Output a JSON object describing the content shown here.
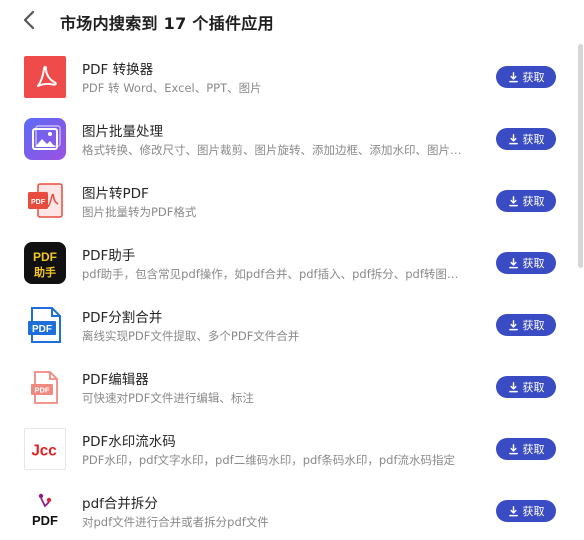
{
  "header": {
    "title": "市场内搜索到 17 个插件应用"
  },
  "plugins": [
    {
      "name": "PDF 转换器",
      "desc": "PDF 转 Word、Excel、PPT、图片",
      "button": "获取",
      "icon": "pdf-converter-icon"
    },
    {
      "name": "图片批量处理",
      "desc": "格式转换、修改尺寸、图片裁剪、图片旋转、添加边框、添加水印、图片…",
      "button": "获取",
      "icon": "image-batch-icon"
    },
    {
      "name": "图片转PDF",
      "desc": "图片批量转为PDF格式",
      "button": "获取",
      "icon": "image-to-pdf-icon"
    },
    {
      "name": "PDF助手",
      "desc": "pdf助手，包含常见pdf操作，如pdf合并、pdf插入、pdf拆分、pdf转图…",
      "button": "获取",
      "icon": "pdf-assistant-icon",
      "icon_text_1": "PDF",
      "icon_text_2": "助手"
    },
    {
      "name": "PDF分割合并",
      "desc": "离线实现PDF文件提取、多个PDF文件合并",
      "button": "获取",
      "icon": "pdf-split-merge-icon",
      "icon_text": "PDF"
    },
    {
      "name": "PDF编辑器",
      "desc": "可快速对PDF文件进行编辑、标注",
      "button": "获取",
      "icon": "pdf-editor-icon",
      "icon_text": "PDF"
    },
    {
      "name": "PDF水印流水码",
      "desc": "PDF水印，pdf文字水印，pdf二维码水印，pdf条码水印，pdf流水码指定",
      "button": "获取",
      "icon": "pdf-watermark-icon",
      "icon_text": "Jcc"
    },
    {
      "name": "pdf合并拆分",
      "desc": "对pdf文件进行合并或者拆分pdf文件",
      "button": "获取",
      "icon": "pdf-merge-split-icon",
      "icon_text": "PDF"
    }
  ],
  "colors": {
    "button": "#3a4cc4",
    "pdf_red": "#ef4b4b",
    "image_purple": "#7b5cf0"
  }
}
